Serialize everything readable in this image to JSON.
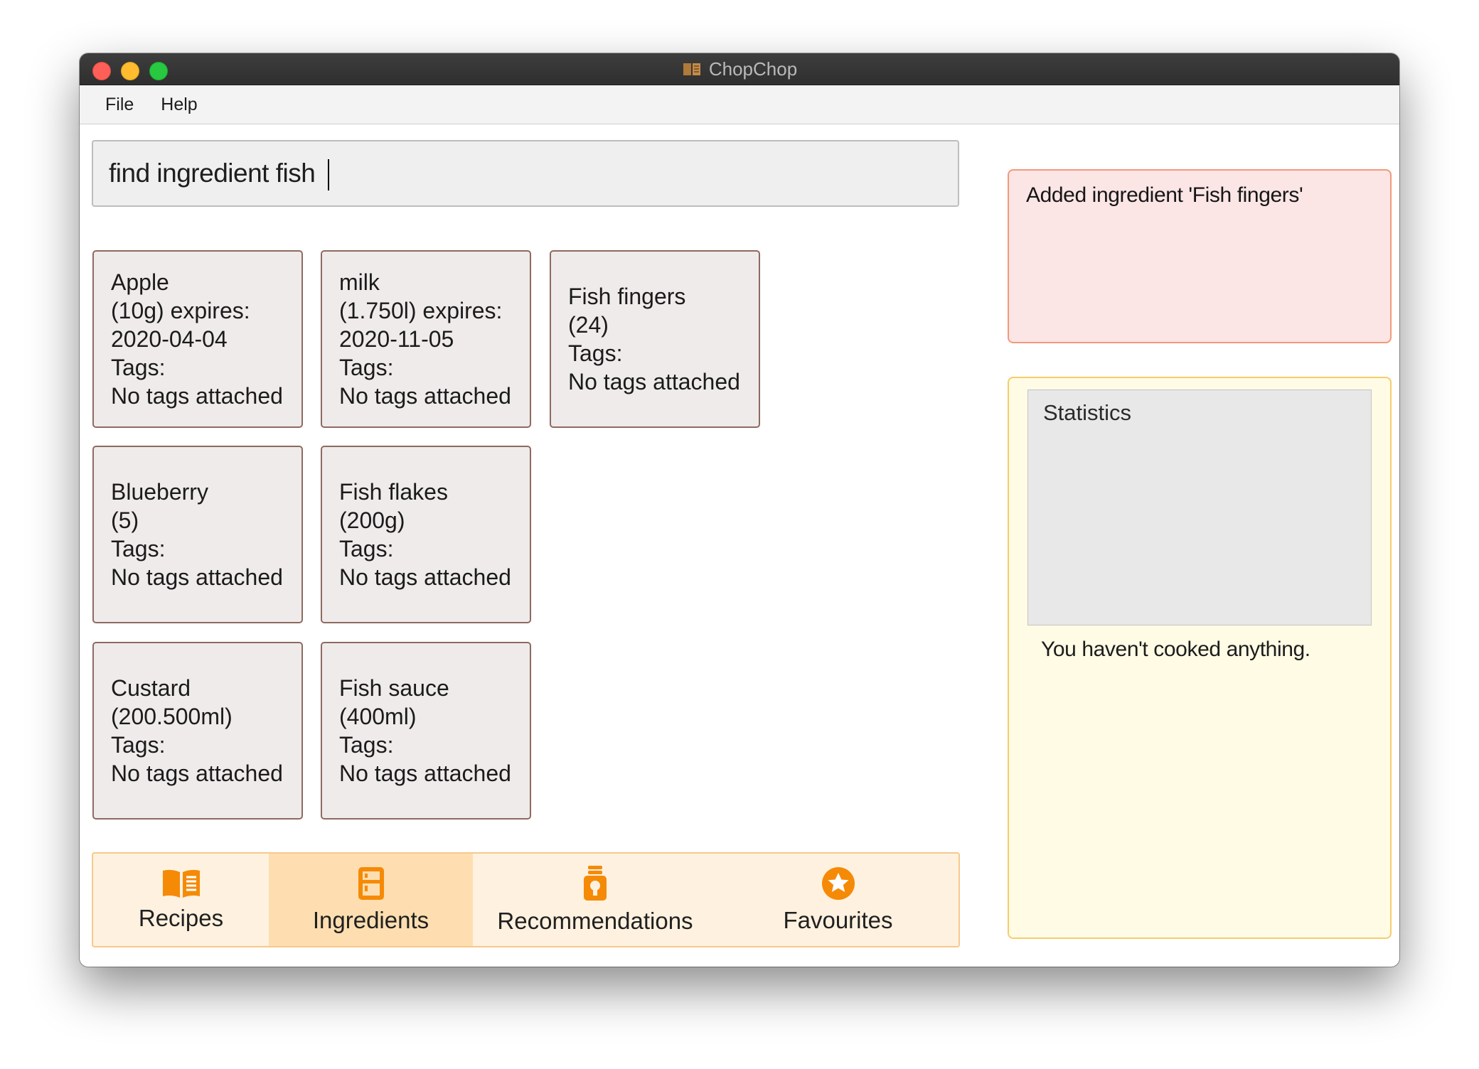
{
  "window": {
    "title": "ChopChop",
    "title_icon": "book-icon"
  },
  "menu": {
    "items": [
      {
        "label": "File"
      },
      {
        "label": "Help"
      }
    ]
  },
  "command": {
    "value": "find ingredient fish"
  },
  "ingredients": [
    {
      "lines": [
        "Apple",
        "(10g) expires:",
        "2020-04-04",
        "Tags:",
        "No tags attached"
      ]
    },
    {
      "lines": [
        "milk",
        "(1.750l) expires:",
        "2020-11-05",
        "Tags:",
        "No tags attached"
      ]
    },
    {
      "lines": [
        "Fish fingers",
        "(24)",
        "Tags:",
        "No tags attached"
      ]
    },
    {
      "lines": [
        "Blueberry",
        "(5)",
        "Tags:",
        "No tags attached"
      ]
    },
    {
      "lines": [
        "Fish flakes",
        "(200g)",
        "Tags:",
        "No tags attached"
      ]
    },
    {
      "lines": [
        "Custard",
        "(200.500ml)",
        "Tags:",
        "No tags attached"
      ]
    },
    {
      "lines": [
        "Fish sauce",
        "(400ml)",
        "Tags:",
        "No tags attached"
      ]
    }
  ],
  "tabs": [
    {
      "label": "Recipes",
      "icon": "recipe-book-icon",
      "active": false
    },
    {
      "label": "Ingredients",
      "icon": "fridge-icon",
      "active": true
    },
    {
      "label": "Recommendations",
      "icon": "lightbulb-icon",
      "active": false
    },
    {
      "label": "Favourites",
      "icon": "star-icon",
      "active": false
    }
  ],
  "result": {
    "message": "Added ingredient 'Fish fingers'"
  },
  "statistics": {
    "header": "Statistics",
    "empty_message": "You haven't cooked anything."
  },
  "colors": {
    "accent_orange": "#f58a07",
    "tab_bg": "#fff1df",
    "tab_active_bg": "#fedeb0",
    "result_bg": "#fbe5e5",
    "result_border": "#f3997c",
    "stats_bg": "#fffbe5",
    "stats_border": "#f4cd6d",
    "card_bg": "#efebea",
    "card_border": "#8e6a60"
  }
}
